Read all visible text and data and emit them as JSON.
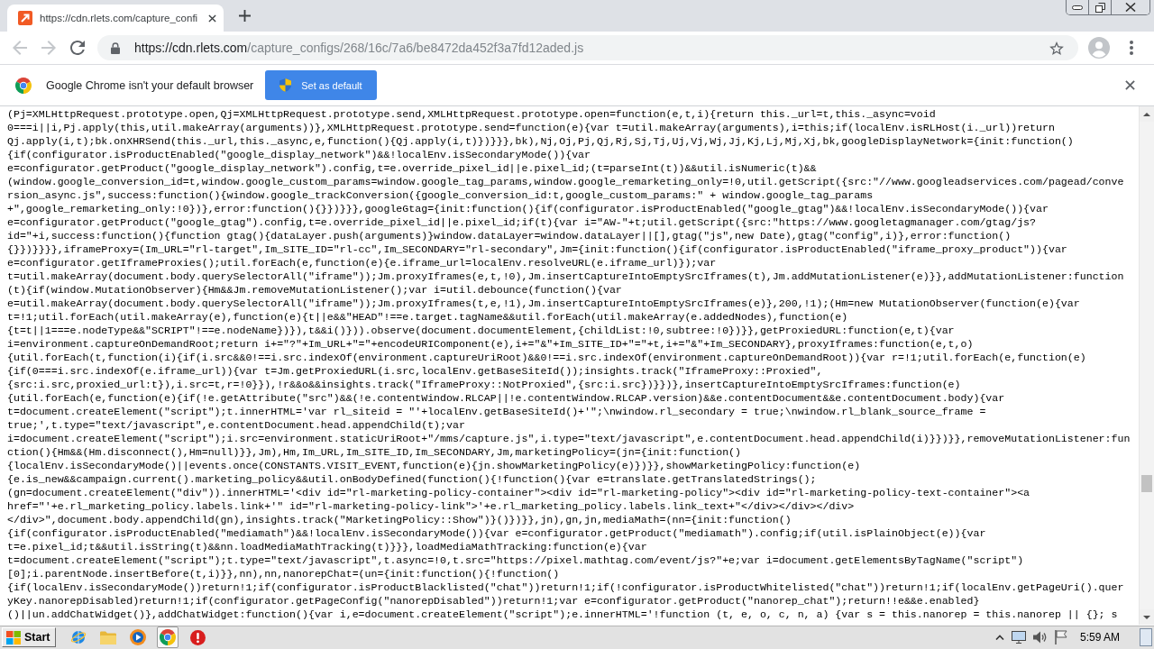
{
  "tabs": [
    {
      "title": "https://cdn.rlets.com/capture_confi",
      "selected": true
    }
  ],
  "nav": {
    "back": {
      "disabled": true
    },
    "forward": {
      "disabled": true
    }
  },
  "address_bar": {
    "host": "https://cdn.rlets.com",
    "path": "/capture_configs/268/16c/7a6/be8472da452f3a7fd12aded.js"
  },
  "infobar": {
    "message": "Google Chrome isn't your default browser",
    "button": "Set as default"
  },
  "code_lines": [
    "(Pj=XMLHttpRequest.prototype.open,Qj=XMLHttpRequest.prototype.send,XMLHttpRequest.prototype.open=function(e,t,i){return this._url=t,this._async=void",
    "0===i||i,Pj.apply(this,util.makeArray(arguments))},XMLHttpRequest.prototype.send=function(e){var t=util.makeArray(arguments),i=this;if(localEnv.isRLHost(i._url))return",
    "Qj.apply(i,t);bk.onXHRSend(this._url,this._async,e,function(){Qj.apply(i,t)})}}},bk),Nj,Oj,Pj,Qj,Rj,Sj,Tj,Uj,Vj,Wj,Jj,Kj,Lj,Mj,Xj,bk,googleDisplayNetwork={init:function()",
    "{if(configurator.isProductEnabled(\"google_display_network\")&&!localEnv.isSecondaryMode()){var",
    "e=configurator.getProduct(\"google_display_network\").config,t=e.override_pixel_id||e.pixel_id;(t=parseInt(t))&&util.isNumeric(t)&&",
    "(window.google_conversion_id=t,window.google_custom_params=window.google_tag_params,window.google_remarketing_only=!0,util.getScript({src:\"//www.googleadservices.com/pagead/conve",
    "rsion_async.js\",success:function(){window.google_trackConversion({google_conversion_id:t,google_custom_params:\" + window.google_tag_params",
    "+\",google_remarketing_only:!0})},error:function(){}})}}},googleGtag={init:function(){if(configurator.isProductEnabled(\"google_gtag\")&&!localEnv.isSecondaryMode()){var",
    "e=configurator.getProduct(\"google_gtag\").config,t=e.override_pixel_id||e.pixel_id;if(t){var i=\"AW-\"+t;util.getScript({src:\"https://www.googletagmanager.com/gtag/js?",
    "id=\"+i,success:function(){function gtag(){dataLayer.push(arguments)}window.dataLayer=window.dataLayer||[],gtag(\"js\",new Date),gtag(\"config\",i)},error:function()",
    "{}})}}}},iframeProxy=(Im_URL=\"rl-target\",Im_SITE_ID=\"rl-cc\",Im_SECONDARY=\"rl-secondary\",Jm={init:function(){if(configurator.isProductEnabled(\"iframe_proxy_product\")){var",
    "e=configurator.getIframeProxies();util.forEach(e,function(e){e.iframe_url=localEnv.resolveURL(e.iframe_url)});var",
    "t=util.makeArray(document.body.querySelectorAll(\"iframe\"));Jm.proxyIframes(e,t,!0),Jm.insertCaptureIntoEmptySrcIframes(t),Jm.addMutationListener(e)}},addMutationListener:function",
    "(t){if(window.MutationObserver){Hm&&Jm.removeMutationListener();var i=util.debounce(function(){var",
    "e=util.makeArray(document.body.querySelectorAll(\"iframe\"));Jm.proxyIframes(t,e,!1),Jm.insertCaptureIntoEmptySrcIframes(e)},200,!1);(Hm=new MutationObserver(function(e){var",
    "t=!1;util.forEach(util.makeArray(e),function(e){t||e&&\"HEAD\"!==e.target.tagName&&util.forEach(util.makeArray(e.addedNodes),function(e)",
    "{t=t||1===e.nodeType&&\"SCRIPT\"!==e.nodeName})}),t&&i()})).observe(document.documentElement,{childList:!0,subtree:!0})}},getProxiedURL:function(e,t){var",
    "i=environment.captureOnDemandRoot;return i+=\"?\"+Im_URL+\"=\"+encodeURIComponent(e),i+=\"&\"+Im_SITE_ID+\"=\"+t,i+=\"&\"+Im_SECONDARY},proxyIframes:function(e,t,o)",
    "{util.forEach(t,function(i){if(i.src&&0!==i.src.indexOf(environment.captureUriRoot)&&0!==i.src.indexOf(environment.captureOnDemandRoot)){var r=!1;util.forEach(e,function(e)",
    "{if(0===i.src.indexOf(e.iframe_url)){var t=Jm.getProxiedURL(i.src,localEnv.getBaseSiteId());insights.track(\"IframeProxy::Proxied\",",
    "{src:i.src,proxied_url:t}),i.src=t,r=!0}}),!r&&o&&insights.track(\"IframeProxy::NotProxied\",{src:i.src})}})},insertCaptureIntoEmptySrcIframes:function(e)",
    "{util.forEach(e,function(e){if(!e.getAttribute(\"src\")&&(!e.contentWindow.RLCAP||!e.contentWindow.RLCAP.version)&&e.contentDocument&&e.contentDocument.body){var",
    "t=document.createElement(\"script\");t.innerHTML='var rl_siteid = \"'+localEnv.getBaseSiteId()+'\";\\nwindow.rl_secondary = true;\\nwindow.rl_blank_source_frame =",
    "true;',t.type=\"text/javascript\",e.contentDocument.head.appendChild(t);var",
    "i=document.createElement(\"script\");i.src=environment.staticUriRoot+\"/mms/capture.js\",i.type=\"text/javascript\",e.contentDocument.head.appendChild(i)}})}},removeMutationListener:fun",
    "ction(){Hm&&(Hm.disconnect(),Hm=null)}},Jm),Hm,Im_URL,Im_SITE_ID,Im_SECONDARY,Jm,marketingPolicy=(jn={init:function()",
    "{localEnv.isSecondaryMode()||events.once(CONSTANTS.VISIT_EVENT,function(e){jn.showMarketingPolicy(e)})}},showMarketingPolicy:function(e)",
    "{e.is_new&&campaign.current().marketing_policy&&util.onBodyDefined(function(){!function(){var e=translate.getTranslatedStrings();",
    "(gn=document.createElement(\"div\")).innerHTML='<div id=\"rl-marketing-policy-container\"><div id=\"rl-marketing-policy\"><div id=\"rl-marketing-policy-text-container\"><a",
    "href=\"'+e.rl_marketing_policy.labels.link+'\" id=\"rl-marketing-policy-link\">'+e.rl_marketing_policy.labels.link_text+\"</div></div></div>",
    "</div>\",document.body.appendChild(gn),insights.track(\"MarketingPolicy::Show\")}()})}},jn),gn,jn,mediaMath=(nn={init:function()",
    "{if(configurator.isProductEnabled(\"mediamath\")&&!localEnv.isSecondaryMode()){var e=configurator.getProduct(\"mediamath\").config;if(util.isPlainObject(e)){var",
    "t=e.pixel_id;t&&util.isString(t)&&nn.loadMediaMathTracking(t)}}},loadMediaMathTracking:function(e){var",
    "t=document.createElement(\"script\");t.type=\"text/javascript\",t.async=!0,t.src=\"https://pixel.mathtag.com/event/js?\"+e;var i=document.getElementsByTagName(\"script\")",
    "[0];i.parentNode.insertBefore(t,i)}},nn),nn,nanorepChat=(un={init:function(){!function()",
    "{if(localEnv.isSecondaryMode())return!1;if(configurator.isProductBlacklisted(\"chat\"))return!1;if(!configurator.isProductWhitelisted(\"chat\"))return!1;if(localEnv.getPageUri().quer",
    "yKey.nanorepDisabled)return!1;if(configurator.getPageConfig(\"nanorepDisabled\"))return!1;var e=configurator.getProduct(\"nanorep_chat\");return!!e&&e.enabled}",
    "()||un.addChatWidget()},addChatWidget:function(){var i,e=document.createElement(\"script\");e.innerHTML='!function (t, e, o, c, n, a) {var s = this.nanorep = this.nanorep || {}; s"
  ],
  "taskbar": {
    "start": "Start",
    "clock": "5:59 AM"
  }
}
